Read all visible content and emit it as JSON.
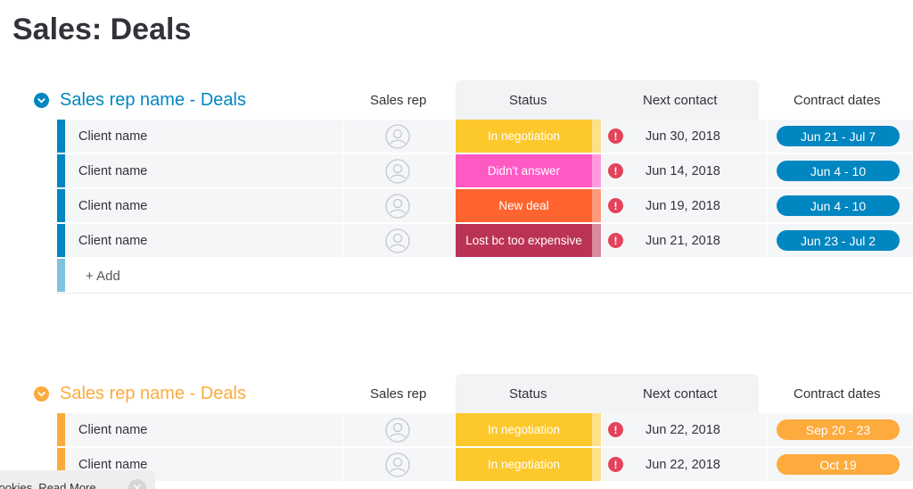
{
  "page": {
    "title": "Sales: Deals"
  },
  "columns": {
    "sales_rep": "Sales rep",
    "status": "Status",
    "next_contact": "Next contact",
    "contract_dates": "Contract dates"
  },
  "groups": [
    {
      "title": "Sales rep name - Deals",
      "color": "#0086c0",
      "add_label": "+ Add",
      "add_bar_color": "#7fc3e0",
      "rows": [
        {
          "name": "Client name",
          "status": "In negotiation",
          "status_color": "#fdc82c",
          "status_edge": "#ffe08a",
          "next_contact": "Jun 30, 2018",
          "contract_dates": "Jun 21 - Jul 7"
        },
        {
          "name": "Client name",
          "status": "Didn't answer",
          "status_color": "#ff5ac4",
          "status_edge": "#ff9bdc",
          "next_contact": "Jun 14, 2018",
          "contract_dates": "Jun 4 - 10"
        },
        {
          "name": "Client name",
          "status": "New deal",
          "status_color": "#ff642e",
          "status_edge": "#ff9a7a",
          "next_contact": "Jun 19, 2018",
          "contract_dates": "Jun 4 - 10"
        },
        {
          "name": "Client name",
          "status": "Lost bc too expensive",
          "status_color": "#bb3354",
          "status_edge": "#d98a9c",
          "next_contact": "Jun 21, 2018",
          "contract_dates": "Jun 23 - Jul 2"
        }
      ]
    },
    {
      "title": "Sales rep name - Deals",
      "color": "#fdab3d",
      "rows": [
        {
          "name": "Client name",
          "status": "In negotiation",
          "status_color": "#fdc82c",
          "status_edge": "#ffe08a",
          "next_contact": "Jun 22, 2018",
          "contract_dates": "Sep 20 - 23"
        },
        {
          "name": "Client name",
          "status": "In negotiation",
          "status_color": "#fdc82c",
          "status_edge": "#ffe08a",
          "next_contact": "Jun 22, 2018",
          "contract_dates": "Oct 19"
        }
      ]
    }
  ],
  "cookie_banner": {
    "text": "cookies. Read More",
    "close_icon": "close-icon"
  }
}
